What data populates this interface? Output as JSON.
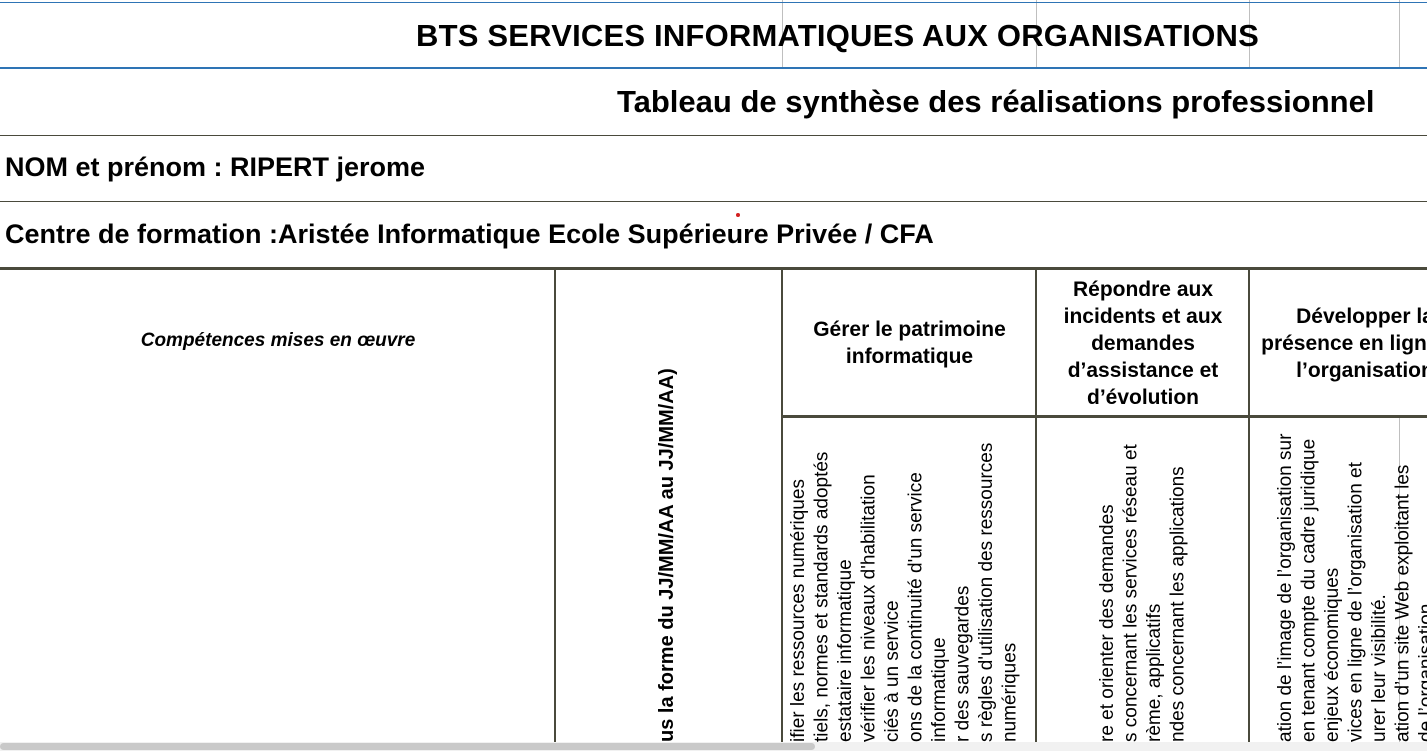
{
  "document": {
    "title": "BTS SERVICES INFORMATIQUES AUX ORGANISATIONS",
    "subtitle": "Tableau de synthèse des réalisations professionnel",
    "student_name_line": "NOM et prénom : RIPERT jerome",
    "training_center_line": "Centre de formation :Aristée Informatique Ecole Supérieure Privée / CFA"
  },
  "table": {
    "competences_label": "Compétences mises en œuvre",
    "date_column_label": "us la forme du JJ/MM/AA au JJ/MM/AA)",
    "blocks": [
      {
        "title": "Gérer le patrimoine informatique",
        "items": [
          "ifier les ressources numériques",
          "tiels, normes et standards adoptés",
          "estataire informatique",
          "vérifier les niveaux d'habilitation",
          "ciés à un service",
          "ons de la continuité d'un service",
          "informatique",
          "r des sauvegardes",
          "s règles d'utilisation des ressources",
          "numériques"
        ]
      },
      {
        "title": "Répondre aux incidents et aux demandes d’assistance et d’évolution",
        "items": [
          "re et orienter des demandes",
          "s concernant les services réseau et",
          "rème, applicatifs",
          "ndes concernant les applications"
        ]
      },
      {
        "title": "Développer la présence en ligne de l’organisation",
        "items": [
          "ation de l’image de l’organisation sur",
          "en tenant compte du cadre juridique",
          "enjeux économiques",
          "vices en ligne de l’organisation et",
          "urer leur visibilité.",
          "ation d’un site Web exploitant les",
          "de l’organisation"
        ]
      }
    ]
  },
  "colors": {
    "border_blue": "#2e74b5",
    "border_dark": "#4a4a3c",
    "border_light": "#bfbfbf",
    "marker_red": "#d21f1f"
  }
}
